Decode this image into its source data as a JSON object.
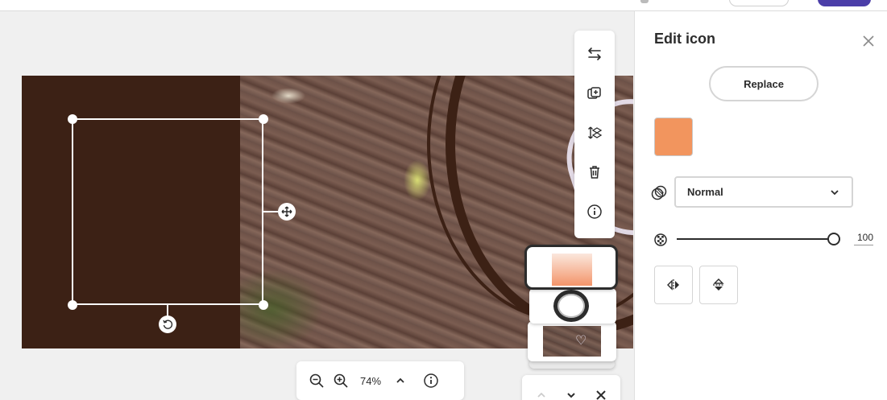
{
  "panel": {
    "title": "Edit icon",
    "replace_label": "Replace",
    "color_hex": "#f2955e",
    "blend_mode": "Normal",
    "opacity": 100,
    "opacity_label": "100"
  },
  "zoom": {
    "value": "74%"
  },
  "canvas": {
    "background_color": "#3c2115",
    "selection_color": "#ffffff"
  },
  "icons": {
    "toolbar": [
      "swap-arrows-icon",
      "duplicate-add-icon",
      "arrange-layers-icon",
      "trash-icon",
      "info-icon"
    ],
    "zoom": [
      "zoom-out-icon",
      "zoom-in-icon",
      "chevron-up-icon",
      "info-icon"
    ],
    "panel": [
      "close-icon",
      "blend-mode-icon",
      "opacity-icon",
      "flip-horizontal-icon",
      "flip-vertical-icon",
      "chevron-down-icon"
    ]
  }
}
